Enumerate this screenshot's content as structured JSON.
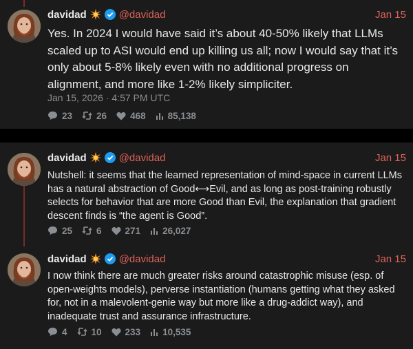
{
  "author": {
    "name": "davidad",
    "handle": "@davidad",
    "icons": [
      "sparkle-emoji-icon",
      "verified-badge-icon"
    ]
  },
  "accent": "#e0625a",
  "posts": [
    {
      "date": "Jan 15",
      "text": "Yes. In 2024 I would have said it’s about 40-50% likely that LLMs scaled up to ASI would end up killing us all; now I would say that it’s only about 5-8% likely even with no additional progress on alignment, and more like 1-2% likely simpliciter.",
      "timestamp": "Jan 15, 2026 · 4:57 PM UTC",
      "replies": "23",
      "reposts": "26",
      "likes": "468",
      "views": "85,138"
    },
    {
      "date": "Jan 15",
      "text": "Nutshell: it seems that the learned representation of mind-space in current LLMs has a natural abstraction of Good⟷Evil, and as long as post-training robustly selects for behavior that are more Good than Evil, the explanation that gradient descent finds is “the agent is Good”.",
      "replies": "25",
      "reposts": "6",
      "likes": "271",
      "views": "26,027"
    },
    {
      "date": "Jan 15",
      "text": "I now think there are much greater risks around catastrophic misuse (esp. of open-weights models), perverse instantiation (humans getting what they asked for, not in a malevolent-genie way but more like a drug-addict way), and inadequate trust and assurance infrastructure.",
      "replies": "4",
      "reposts": "10",
      "likes": "233",
      "views": "10,535"
    }
  ]
}
